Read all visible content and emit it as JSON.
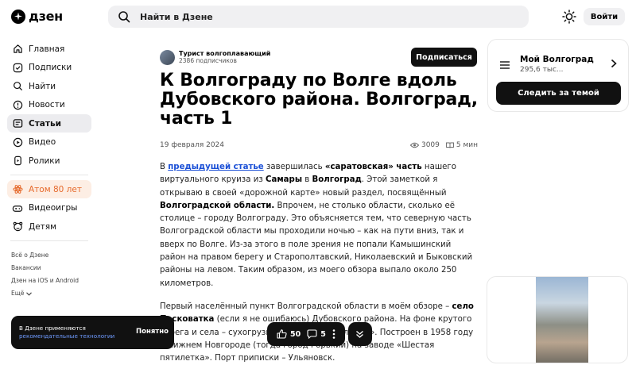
{
  "header": {
    "logo_text": "дзен",
    "search_placeholder": "Найти в Дзене",
    "login_label": "Войти"
  },
  "sidebar": {
    "items": [
      {
        "label": "Главная",
        "icon": "home-icon"
      },
      {
        "label": "Подписки",
        "icon": "subscriptions-icon"
      },
      {
        "label": "Найти",
        "icon": "search-icon"
      },
      {
        "label": "Новости",
        "icon": "news-icon"
      },
      {
        "label": "Статьи",
        "icon": "articles-icon",
        "active": true
      },
      {
        "label": "Видео",
        "icon": "video-icon"
      },
      {
        "label": "Ролики",
        "icon": "shorts-icon"
      }
    ],
    "special_item": {
      "label": "Атом 80 лет",
      "icon": "atom-icon",
      "color": "#e66a2c"
    },
    "extra_items": [
      {
        "label": "Видеоигры",
        "icon": "gamepad-icon"
      },
      {
        "label": "Детям",
        "icon": "kids-icon"
      }
    ],
    "footer_links": [
      "Всё о Дзене",
      "Вакансии",
      "Дзен на iOS и Android",
      "Ещё"
    ]
  },
  "article": {
    "author_name": "Турист волгоплавающий",
    "author_subs": "2386 подписчиков",
    "subscribe_label": "Подписаться",
    "title": "К Волгограду по Волге вдоль Дубовского района. Волгоград, часть 1",
    "date": "19 февраля 2024",
    "views": "3009",
    "read_time": "5 мин",
    "p1": {
      "t1": "В ",
      "link": "предыдущей статье",
      "t2": " завершилась ",
      "b1": "«саратовская» часть",
      "t3": " нашего виртуального круиза из ",
      "b2": "Самары",
      "t4": " в ",
      "b3": "Волгоград",
      "t5": ". Этой заметкой я открываю в своей «дорожной карте» новый раздел, посвящённый ",
      "b4": "Волгоградской области.",
      "t6": " Впрочем, не столько области, сколько её столице – городу Волгограду. Это объясняется тем, что северную часть Волгоградской области мы проходили ночью – как на пути вниз, так и вверх по Волге. Из-за этого в поле зрения не попали Камышинский район на правом берегу и Старополтавский, Николаевский и Быковский районы на левом. Таким образом, из моего обзора выпало около 250 километров."
    },
    "p2": {
      "t1": "Первый населённый пункт Волгоградской области в моём обзоре – ",
      "b1": "село Песковатка",
      "t2": " (если я не ошибаюсь) Дубовского района. На фоне крутого берега и села – сухогрузный теплоход «Гольяны». Построен в 1958 году в Нижнем Новгороде (тогда город Горький) на заводе «Шестая пятилетка». Порт приписки – Ульяновск."
    }
  },
  "channel_card": {
    "title": "Мой Волгоград",
    "subs": "295,6 тыс...",
    "follow_label": "Следить за темой"
  },
  "cookie": {
    "text": "В Дзене применяются",
    "link": "рекомендательные технологии",
    "ok_label": "Понятно"
  },
  "actions": {
    "likes": "50",
    "comments": "5"
  }
}
